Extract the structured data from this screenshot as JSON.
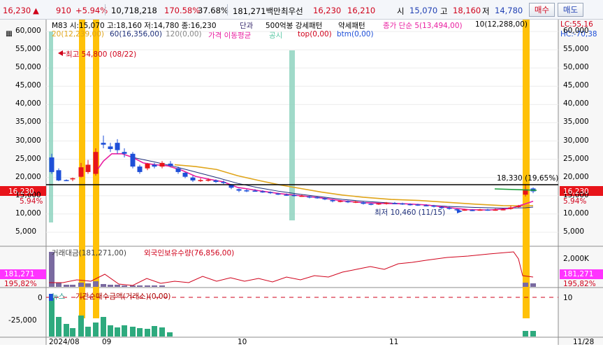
{
  "quote": {
    "price": "16,230",
    "change": "910",
    "change_pct": "+5.94%",
    "volume": "10,718,218",
    "vol_ratio": "170.58%",
    "turnover": "37.68%",
    "amount": "181,271백만",
    "best_ask_label": "최우선",
    "best_ask": "16,230",
    "best_bid": "16,210",
    "open_label": "시",
    "open": "15,070",
    "high_label": "고",
    "high": "18,160",
    "low_label": "저",
    "low": "14,780",
    "buy_label": "매수",
    "sell_label": "매도"
  },
  "price_panel": {
    "legend1": {
      "ohlc": "M83 시:15,070 고:18,160 저:14,780 종:16,230",
      "danga": "단과",
      "b500": "500억봉 강세패턴",
      "weak": "약세패턴",
      "ma5": "종가 단순 5(13,494,00)",
      "ma10": "10(12,288,00)",
      "lc": "LC:55,16"
    },
    "legend2": {
      "ma20": "20(12,239,00)",
      "ma60": "60(16,356,00)",
      "ma120": "120(0,00)",
      "ma_label": "가격 이동평균",
      "gongsi": "공시",
      "top": "top(0,00)",
      "btm": "btm(0,00)",
      "hc": "HC:-70,38"
    },
    "y_ticks": [
      "60,000",
      "55,000",
      "50,000",
      "45,000",
      "40,000",
      "35,000",
      "30,000",
      "25,000",
      "20,000",
      "15,000",
      "10,000",
      "5,000"
    ],
    "right_ticks": [
      "60,000",
      "55,000",
      "50,000",
      "45,000",
      "40,000",
      "35,000",
      "30,000",
      "25,000",
      "20,000",
      "15,000",
      "10,000",
      "5,000"
    ],
    "current_price": "16,230",
    "current_pct": "5.94%",
    "high_annot": "최고 54,800 (08/22)",
    "low_annot": "최저 10,460 (11/15)",
    "target_annot": "18,330 (19,65%)"
  },
  "volume_panel": {
    "legend_vol": "거래대금(181,271,00)",
    "legend_foreign": "외국인보유수량(76,856,00)",
    "tick": "2,000K",
    "current": "181,271",
    "current_pct": "195,82%"
  },
  "flow_panel": {
    "legend_news": "뉴스",
    "legend_inst": "기관순매수금액(거래소)(0,00)",
    "tick_left_0": "0",
    "tick_left_1": "-25,000",
    "tick_right_10": "10"
  },
  "x_labels": [
    "2024/08",
    "09",
    "10",
    "11",
    "11/28"
  ],
  "colors": {
    "up": "#e8141a",
    "down": "#1e4fd8",
    "ma5": "#e91ea0",
    "ma20": "#e0a51a",
    "ma60": "#1e2f7a",
    "highlight_yellow": "#ffc107",
    "highlight_green": "#8fd4bf"
  }
}
